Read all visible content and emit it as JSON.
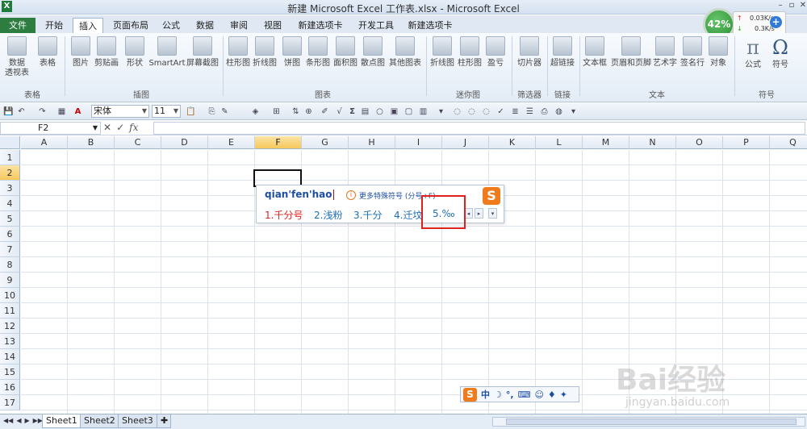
{
  "window": {
    "title": "新建 Microsoft Excel 工作表.xlsx - Microsoft Excel",
    "app_icon": "X"
  },
  "tabs": [
    "文件",
    "开始",
    "插入",
    "页面布局",
    "公式",
    "数据",
    "审阅",
    "视图",
    "新建选项卡",
    "开发工具",
    "新建选项卡"
  ],
  "active_tab": "插入",
  "network": {
    "percent": "42%",
    "upload": "0.03K/s",
    "download": "0.3K/s"
  },
  "ribbon": {
    "table_group": {
      "label": "表格",
      "pivot": "数据\n透视表",
      "table": "表格"
    },
    "illustration_group": {
      "label": "插图",
      "picture": "图片",
      "clipart": "剪贴画",
      "shapes": "形状",
      "smartart": "SmartArt",
      "screenshot": "屏幕截图"
    },
    "chart_group": {
      "label": "图表",
      "column": "柱形图",
      "line": "折线图",
      "pie": "饼图",
      "bar": "条形图",
      "area": "面积图",
      "scatter": "散点图",
      "other": "其他图表"
    },
    "sparkline_group": {
      "label": "迷你图",
      "line": "折线图",
      "column": "柱形图",
      "winloss": "盈亏"
    },
    "filter_group": {
      "label": "筛选器",
      "slicer": "切片器"
    },
    "link_group": {
      "label": "链接",
      "hyperlink": "超链接"
    },
    "text_group": {
      "label": "文本",
      "textbox": "文本框",
      "header_footer": "页眉和页脚",
      "wordart": "艺术字",
      "signature": "签名行",
      "object": "对象"
    },
    "symbol_group": {
      "label": "符号",
      "equation": "公式",
      "symbol": "符号",
      "equation_glyph": "π",
      "symbol_glyph": "Ω"
    }
  },
  "format_toolbar": {
    "font": "宋体",
    "size": "11"
  },
  "formula_bar": {
    "name_box": "F2",
    "formula": ""
  },
  "columns": [
    "A",
    "B",
    "C",
    "D",
    "E",
    "F",
    "G",
    "H",
    "I",
    "J",
    "K",
    "L",
    "M",
    "N",
    "O",
    "P",
    "Q"
  ],
  "rows": [
    "1",
    "2",
    "3",
    "4",
    "5",
    "6",
    "7",
    "8",
    "9",
    "10",
    "11",
    "12",
    "13",
    "14",
    "15",
    "16",
    "17"
  ],
  "selected_cell": {
    "col": "F",
    "row": "2"
  },
  "ime": {
    "pinyin": "qian'fen'hao",
    "hint": "更多特殊符号 (分号+F)",
    "candidates": [
      "1.千分号",
      "2.浅粉",
      "3.千分",
      "4.迁坟",
      "5.‰"
    ]
  },
  "ime_status": {
    "logo": "S",
    "mode": "中",
    "moon": "☽",
    "punct": "°,"
  },
  "sheets": [
    "Sheet1",
    "Sheet2",
    "Sheet3"
  ],
  "active_sheet": "Sheet1",
  "watermark": {
    "text": "Bai经验",
    "url": "jingyan.baidu.com"
  }
}
